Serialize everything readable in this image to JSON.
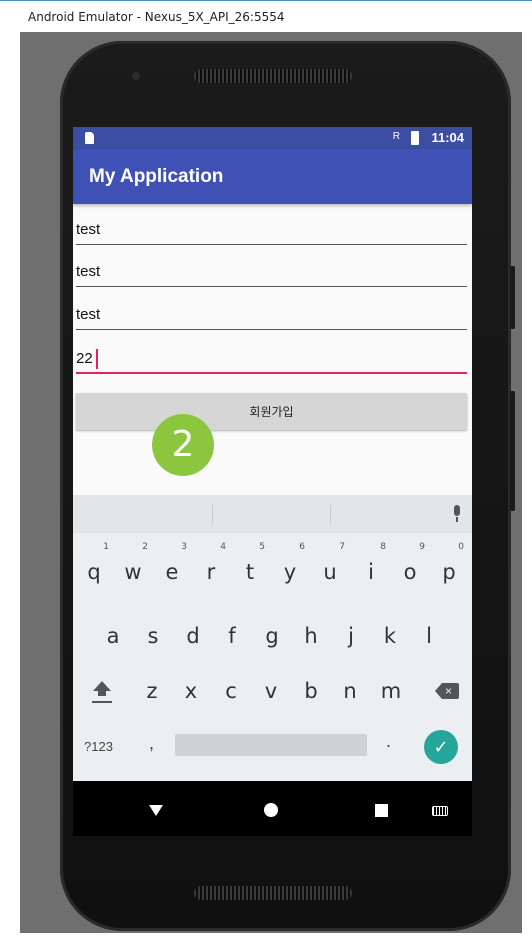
{
  "window": {
    "title": "Android Emulator - Nexus_5X_API_26:5554"
  },
  "status_bar": {
    "time": "11:04",
    "signal_label": "R"
  },
  "app": {
    "title": "My Application"
  },
  "form": {
    "fields": [
      {
        "value": "test"
      },
      {
        "value": "test"
      },
      {
        "value": "test"
      },
      {
        "value": "22"
      }
    ],
    "signup_button": "회원가입"
  },
  "step_badge": "2",
  "keyboard": {
    "row1": [
      {
        "key": "q",
        "hint": "1"
      },
      {
        "key": "w",
        "hint": "2"
      },
      {
        "key": "e",
        "hint": "3"
      },
      {
        "key": "r",
        "hint": "4"
      },
      {
        "key": "t",
        "hint": "5"
      },
      {
        "key": "y",
        "hint": "6"
      },
      {
        "key": "u",
        "hint": "7"
      },
      {
        "key": "i",
        "hint": "8"
      },
      {
        "key": "o",
        "hint": "9"
      },
      {
        "key": "p",
        "hint": "0"
      }
    ],
    "row2": [
      "a",
      "s",
      "d",
      "f",
      "g",
      "h",
      "j",
      "k",
      "l"
    ],
    "row3": [
      "z",
      "x",
      "c",
      "v",
      "b",
      "n",
      "m"
    ],
    "symbols_key": "?123",
    "comma_key": ",",
    "period_key": ".",
    "enter_glyph": "✓"
  },
  "colors": {
    "primary": "#3f51b5",
    "accent": "#e91e63",
    "badge": "#8cc63f",
    "enter": "#26a69a"
  },
  "icons": {
    "sd_card": "sd-card-icon",
    "battery": "battery-icon",
    "mic": "mic-icon",
    "shift": "shift-icon",
    "backspace": "backspace-icon",
    "back": "back-icon",
    "home": "home-icon",
    "recents": "recents-icon",
    "keyboard_switch": "keyboard-icon"
  }
}
